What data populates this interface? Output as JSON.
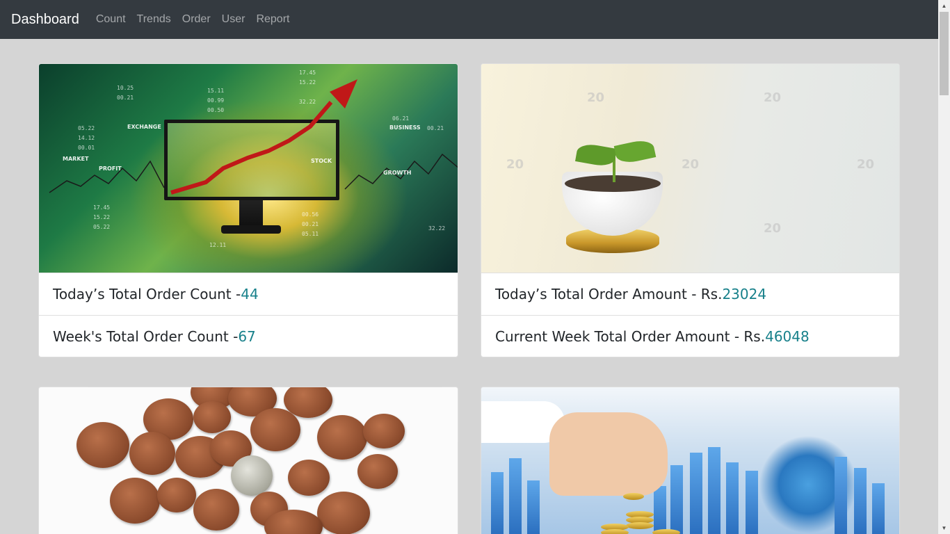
{
  "navbar": {
    "brand": "Dashboard",
    "links": [
      "Count",
      "Trends",
      "Order",
      "User",
      "Report"
    ]
  },
  "cards": [
    {
      "image": "stock-market-monitor-image",
      "rows": [
        {
          "label": "Today’s Total Order Count - ",
          "value": "44"
        },
        {
          "label": "Week's Total Order Count - ",
          "value": "67"
        }
      ]
    },
    {
      "image": "plant-in-eggshell-image",
      "rows": [
        {
          "label": "Today’s Total Order Amount - Rs.",
          "value": "23024"
        },
        {
          "label": "Current Week Total Order Amount - Rs.",
          "value": "46048"
        }
      ]
    },
    {
      "image": "pile-of-coins-image",
      "rows": []
    },
    {
      "image": "hand-stacking-coins-image",
      "rows": []
    }
  ],
  "stock_image_text": {
    "words": [
      "EXCHANGE",
      "MARKET",
      "PROFIT",
      "STOCK",
      "BUSINESS",
      "GROWTH"
    ],
    "numbers": [
      "10.25",
      "00.21",
      "15.11",
      "00.99",
      "00.50",
      "17.45",
      "15.22",
      "32.22",
      "06.21",
      "00.21",
      "05.22",
      "00.01",
      "14.12",
      "17.45",
      "15.22",
      "05.22",
      "00.56",
      "00.21",
      "05.11",
      "32.22",
      "12.11"
    ]
  },
  "plant_image_watermark": "20",
  "colors": {
    "navbar_bg": "#343a40",
    "page_bg": "#d5d5d5",
    "value_color": "#17808a"
  }
}
